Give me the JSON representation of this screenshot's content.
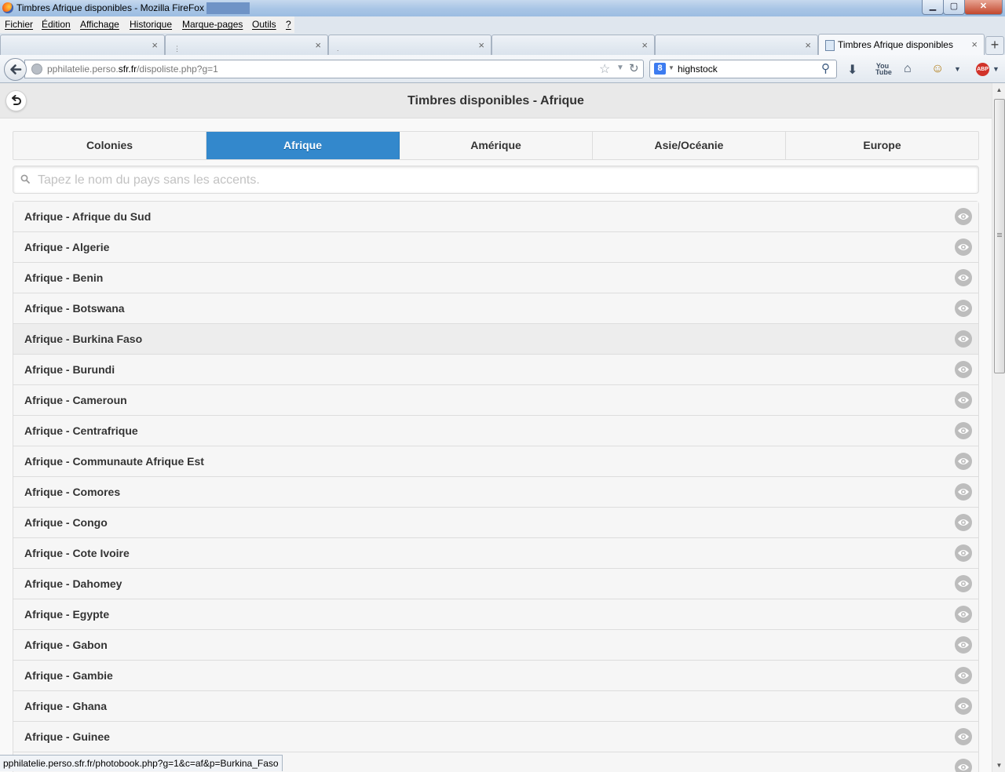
{
  "window": {
    "title": "Timbres Afrique disponibles - Mozilla FireFox",
    "minimize": "▁",
    "maximize": "▢",
    "close": "✕"
  },
  "menu": [
    "Fichier",
    "Édition",
    "Affichage",
    "Historique",
    "Marque-pages",
    "Outils",
    "?"
  ],
  "tabs": [
    {
      "label": "",
      "close": "×"
    },
    {
      "label": "",
      "close": "×"
    },
    {
      "label": "",
      "close": "×"
    },
    {
      "label": "",
      "close": "×"
    },
    {
      "label": "",
      "close": "×"
    },
    {
      "label": "Timbres Afrique disponibles",
      "close": "×",
      "active": true
    }
  ],
  "new_tab": "+",
  "toolbar": {
    "url_prefix": "pphilatelie.perso.",
    "url_domain": "sfr.fr",
    "url_suffix": "/dispoliste.php?g=1",
    "search_engine_icon": "google-icon",
    "search_engine_letter": "8",
    "search_query": "highstock",
    "abp_label": "ABP",
    "icons": [
      "download-icon",
      "youtube-icon",
      "home-icon",
      "greasemonkey-icon",
      "menu-dropdown-icon",
      "adblock-icon"
    ]
  },
  "page": {
    "title": "Timbres disponibles - Afrique",
    "nav_tabs": [
      "Colonies",
      "Afrique",
      "Amérique",
      "Asie/Océanie",
      "Europe"
    ],
    "active_tab": "Afrique",
    "search_placeholder": "Tapez le nom du pays sans les accents.",
    "search_value": "",
    "items": [
      "Afrique - Afrique du Sud",
      "Afrique - Algerie",
      "Afrique - Benin",
      "Afrique - Botswana",
      "Afrique - Burkina Faso",
      "Afrique - Burundi",
      "Afrique - Cameroun",
      "Afrique - Centrafrique",
      "Afrique - Communaute Afrique Est",
      "Afrique - Comores",
      "Afrique - Congo",
      "Afrique - Cote Ivoire",
      "Afrique - Dahomey",
      "Afrique - Egypte",
      "Afrique - Gabon",
      "Afrique - Gambie",
      "Afrique - Ghana",
      "Afrique - Guinee",
      ""
    ],
    "hovered_item": "Afrique - Burkina Faso"
  },
  "status_bar": "pphilatelie.perso.sfr.fr/photobook.php?g=1&c=af&p=Burkina_Faso",
  "colors": {
    "active_tab_bg": "#3388cc",
    "row_bg": "#f6f6f6",
    "row_hover_bg": "#ededed",
    "eye_icon_bg": "#bdbdbd"
  }
}
